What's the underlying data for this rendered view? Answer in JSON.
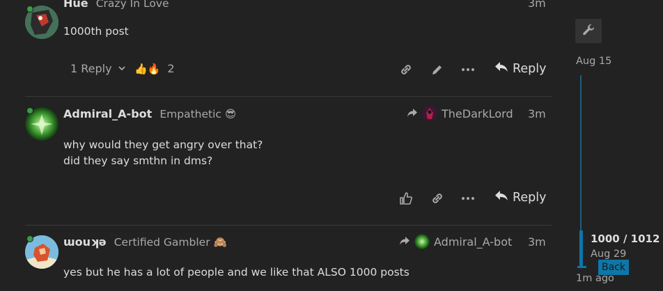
{
  "posts": [
    {
      "username": "Hue",
      "user_title": "Crazy In Love",
      "time": "3m",
      "body": [
        "1000th post"
      ],
      "replies_label": "1 Reply",
      "reaction_emojis": "👍🔥",
      "reaction_count": "2",
      "reply_label": "Reply"
    },
    {
      "username": "Admiral_A-bot",
      "user_title": "Empathetic 😎",
      "reply_to_user": "TheDarkLord",
      "time": "3m",
      "body": [
        "why would they get angry over that?",
        "did they say smthn in dms?"
      ],
      "reply_label": "Reply"
    },
    {
      "username": "ɯouʞǝ",
      "user_title": "Certified Gambler 🙈",
      "reply_to_user": "Admiral_A-bot",
      "time": "3m",
      "body": [
        "yes but he has a lot of people and we like that ALSO 1000 posts"
      ]
    }
  ],
  "timeline": {
    "top_date": "Aug 15",
    "position": "1000 / 1012",
    "position_date": "Aug 29",
    "back_label": "Back",
    "bottom_label": "1m ago",
    "progress_fraction": 0.988
  },
  "colors": {
    "background": "#222222",
    "accent": "#0e76a8",
    "online": "#3c9b47",
    "muted": "#a9a9a9",
    "text": "#dddddd"
  },
  "icons": [
    "wrench-icon",
    "link-icon",
    "pencil-icon",
    "ellipsis-icon",
    "reply-arrow-icon",
    "like-icon",
    "chevron-down-icon",
    "share-arrow-icon"
  ]
}
